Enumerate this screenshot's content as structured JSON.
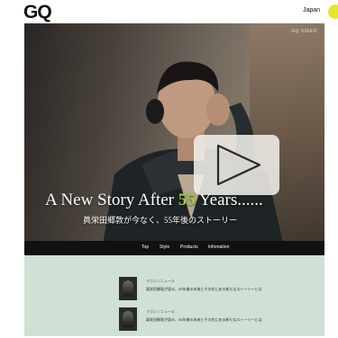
{
  "header": {
    "logo": "GQ",
    "region": "Japan"
  },
  "hero": {
    "corner_label": "GQ VIDEO",
    "headline_pre": "A New Story After ",
    "headline_num": "55",
    "headline_post": " Years......",
    "subheadline": "眞栄田郷敦が今なく、55年後のストーリー"
  },
  "nav": {
    "items": [
      "Top",
      "Style",
      "Products",
      "Infomation"
    ]
  },
  "articles": [
    {
      "category": "マガジンニュース",
      "title": "眞栄田郷敦が語る、55年後の未来とその先にある新たなストーリーとは"
    },
    {
      "category": "マガジンニュース",
      "title": "眞栄田郷敦が語る、55年後の未来とその先にある新たなストーリーとは"
    }
  ],
  "colors": {
    "accent_green": "#9bd12e",
    "nav_bg": "#111111",
    "content_bg": "#cfe0d5",
    "profile_yellow": "#e9e52a"
  },
  "icons": {
    "play": "play-icon",
    "profile": "profile-icon"
  }
}
